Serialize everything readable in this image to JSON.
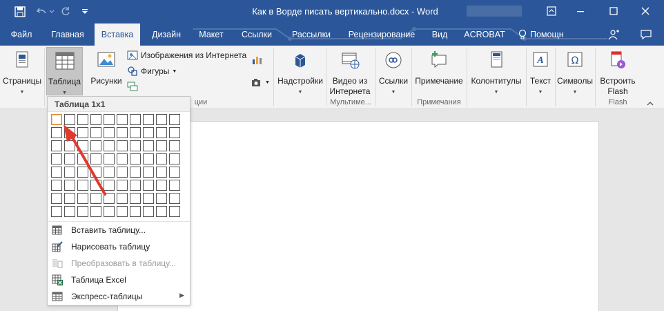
{
  "window": {
    "title": "Как в Ворде писать вертикально.docx - Word"
  },
  "tabs": [
    {
      "label": "Файл"
    },
    {
      "label": "Главная"
    },
    {
      "label": "Вставка",
      "active": true
    },
    {
      "label": "Дизайн"
    },
    {
      "label": "Макет"
    },
    {
      "label": "Ссылки"
    },
    {
      "label": "Рассылки"
    },
    {
      "label": "Рецензирование"
    },
    {
      "label": "Вид"
    },
    {
      "label": "ACROBAT"
    },
    {
      "label": "Помощн"
    }
  ],
  "ribbon": {
    "pages": "Страницы",
    "table": "Таблица",
    "pictures": "Рисунки",
    "online_pictures": "Изображения из Интернета",
    "shapes": "Фигуры",
    "illustrations_group": "ции",
    "addins": "Надстройки",
    "video_line1": "Видео из",
    "video_line2": "Интернета",
    "media_group": "Мультиме...",
    "links": "Ссылки",
    "comment": "Примечание",
    "comments_group": "Примечания",
    "header_footer": "Колонтитулы",
    "text": "Текст",
    "symbols": "Символы",
    "flash_line1": "Встроить",
    "flash_line2": "Flash",
    "flash_group": "Flash"
  },
  "dropdown": {
    "header": "Таблица 1x1",
    "grid": {
      "columns": 10,
      "rows": 8,
      "selected_cols": 1,
      "selected_rows": 1
    },
    "items": [
      {
        "label": "Вставить таблицу...",
        "icon": "insert-table-icon",
        "disabled": false
      },
      {
        "label": "Нарисовать таблицу",
        "icon": "draw-table-icon",
        "disabled": false
      },
      {
        "label": "Преобразовать в таблицу...",
        "icon": "convert-table-icon",
        "disabled": true
      },
      {
        "label": "Таблица Excel",
        "icon": "excel-table-icon",
        "disabled": false
      },
      {
        "label": "Экспресс-таблицы",
        "icon": "quick-tables-icon",
        "disabled": false
      }
    ]
  },
  "colors": {
    "brand": "#2b579a",
    "ribbon_bg": "#f3f3f3",
    "annotation_arrow": "#e03a2f"
  }
}
